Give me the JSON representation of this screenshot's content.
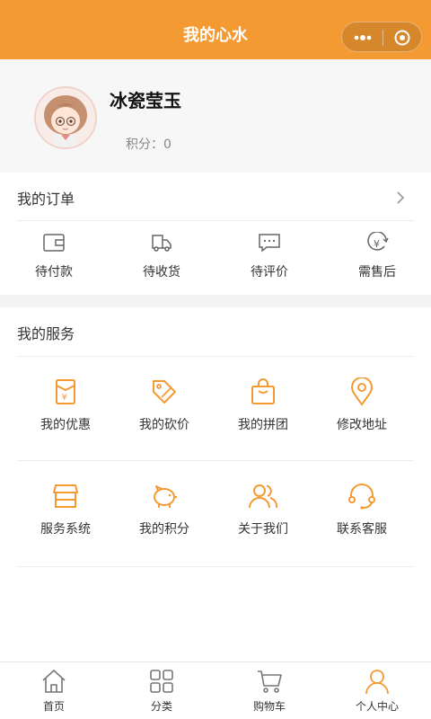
{
  "header": {
    "title": "我的心水"
  },
  "profile": {
    "username": "冰瓷莹玉",
    "points_label": "积分：0"
  },
  "orders": {
    "title": "我的订单",
    "items": [
      {
        "label": "待付款",
        "icon": "wallet-icon"
      },
      {
        "label": "待收货",
        "icon": "truck-icon"
      },
      {
        "label": "待评价",
        "icon": "comment-icon"
      },
      {
        "label": "需售后",
        "icon": "refund-icon"
      }
    ]
  },
  "services": {
    "title": "我的服务",
    "items": [
      {
        "label": "我的优惠",
        "icon": "coupon-icon"
      },
      {
        "label": "我的砍价",
        "icon": "tag-icon"
      },
      {
        "label": "我的拼团",
        "icon": "bag-icon"
      },
      {
        "label": "修改地址",
        "icon": "location-icon"
      },
      {
        "label": "服务系统",
        "icon": "store-icon"
      },
      {
        "label": "我的积分",
        "icon": "piggy-bank-icon"
      },
      {
        "label": "关于我们",
        "icon": "users-icon"
      },
      {
        "label": "联系客服",
        "icon": "headset-icon"
      }
    ]
  },
  "tabbar": {
    "items": [
      {
        "label": "首页",
        "icon": "home-icon"
      },
      {
        "label": "分类",
        "icon": "grid-icon"
      },
      {
        "label": "购物车",
        "icon": "cart-icon"
      },
      {
        "label": "个人中心",
        "icon": "person-icon"
      }
    ],
    "active_color": "#f49a33"
  },
  "colors": {
    "accent": "#f49a33",
    "icon_gray": "#666666"
  }
}
